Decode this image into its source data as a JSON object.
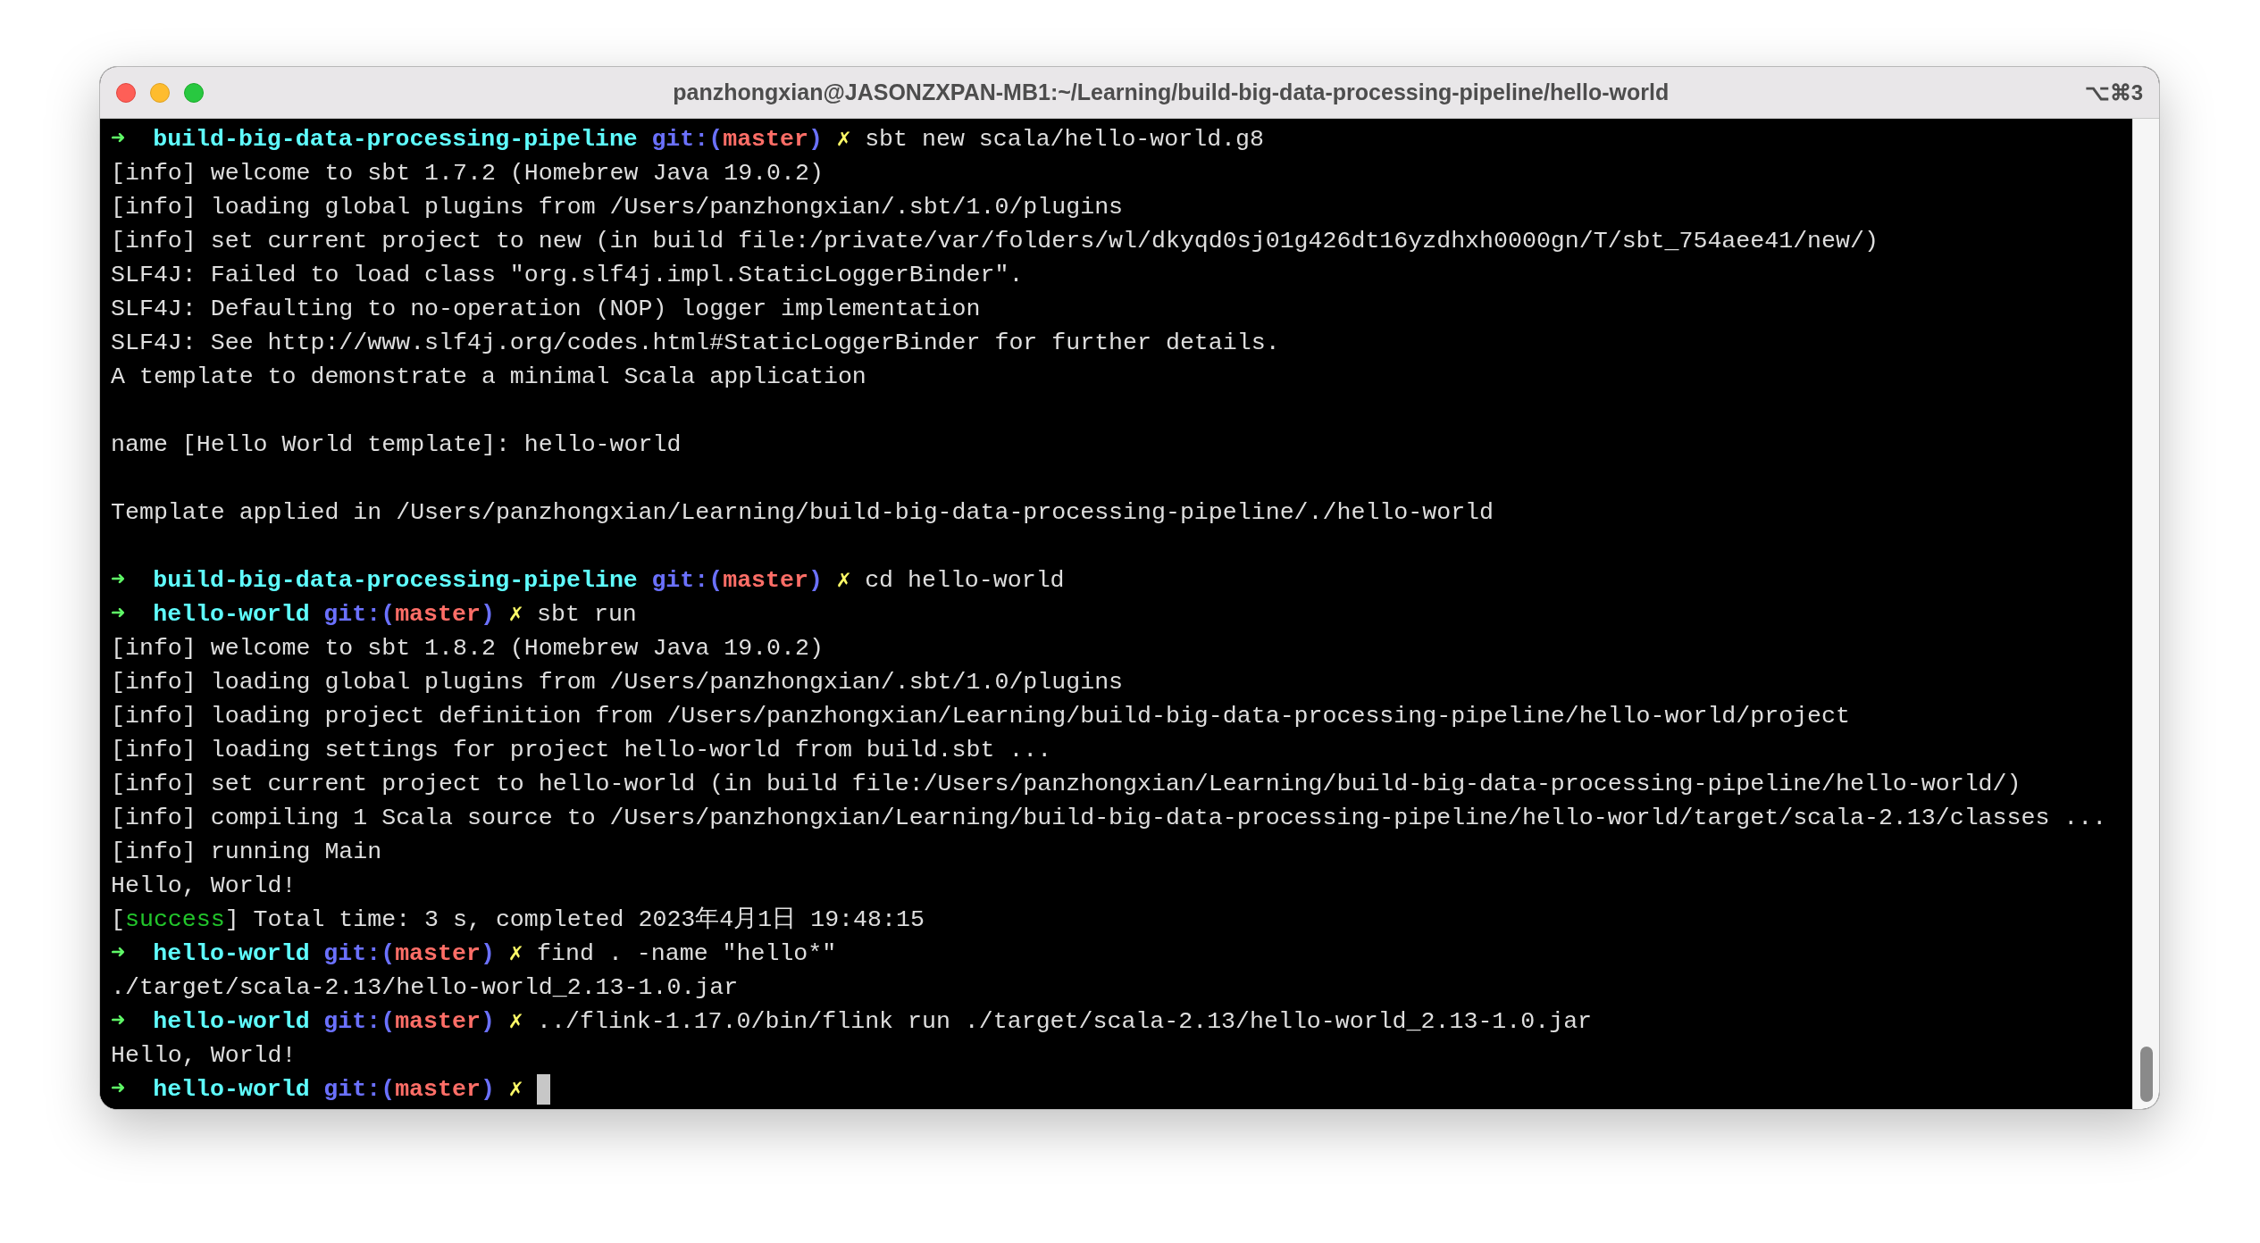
{
  "window": {
    "title": "panzhongxian@JASONZXPAN-MB1:~/Learning/build-big-data-processing-pipeline/hello-world",
    "shortcut": "⌥⌘3"
  },
  "lines": [
    {
      "kind": "prompt",
      "arrow": "➜",
      "dir": "build-big-data-processing-pipeline",
      "git_prefix": "git:(",
      "branch": "master",
      "git_suffix": ")",
      "dirty": "✗",
      "command": "sbt new scala/hello-world.g8",
      "cursor": false
    },
    {
      "kind": "output",
      "text": "[info] welcome to sbt 1.7.2 (Homebrew Java 19.0.2)"
    },
    {
      "kind": "output",
      "text": "[info] loading global plugins from /Users/panzhongxian/.sbt/1.0/plugins"
    },
    {
      "kind": "output",
      "text": "[info] set current project to new (in build file:/private/var/folders/wl/dkyqd0sj01g426dt16yzdhxh0000gn/T/sbt_754aee41/new/)"
    },
    {
      "kind": "output",
      "text": "SLF4J: Failed to load class \"org.slf4j.impl.StaticLoggerBinder\"."
    },
    {
      "kind": "output",
      "text": "SLF4J: Defaulting to no-operation (NOP) logger implementation"
    },
    {
      "kind": "output",
      "text": "SLF4J: See http://www.slf4j.org/codes.html#StaticLoggerBinder for further details."
    },
    {
      "kind": "output",
      "text": "A template to demonstrate a minimal Scala application"
    },
    {
      "kind": "blank"
    },
    {
      "kind": "output",
      "text": "name [Hello World template]: hello-world"
    },
    {
      "kind": "blank"
    },
    {
      "kind": "output",
      "text": "Template applied in /Users/panzhongxian/Learning/build-big-data-processing-pipeline/./hello-world"
    },
    {
      "kind": "blank"
    },
    {
      "kind": "prompt",
      "arrow": "➜",
      "dir": "build-big-data-processing-pipeline",
      "git_prefix": "git:(",
      "branch": "master",
      "git_suffix": ")",
      "dirty": "✗",
      "command": "cd hello-world",
      "cursor": false
    },
    {
      "kind": "prompt",
      "arrow": "➜",
      "dir": "hello-world",
      "git_prefix": "git:(",
      "branch": "master",
      "git_suffix": ")",
      "dirty": "✗",
      "command": "sbt run",
      "cursor": false
    },
    {
      "kind": "output",
      "text": "[info] welcome to sbt 1.8.2 (Homebrew Java 19.0.2)"
    },
    {
      "kind": "output",
      "text": "[info] loading global plugins from /Users/panzhongxian/.sbt/1.0/plugins"
    },
    {
      "kind": "output",
      "text": "[info] loading project definition from /Users/panzhongxian/Learning/build-big-data-processing-pipeline/hello-world/project"
    },
    {
      "kind": "output",
      "text": "[info] loading settings for project hello-world from build.sbt ..."
    },
    {
      "kind": "output",
      "text": "[info] set current project to hello-world (in build file:/Users/panzhongxian/Learning/build-big-data-processing-pipeline/hello-world/)"
    },
    {
      "kind": "output",
      "text": "[info] compiling 1 Scala source to /Users/panzhongxian/Learning/build-big-data-processing-pipeline/hello-world/target/scala-2.13/classes ..."
    },
    {
      "kind": "output",
      "text": "[info] running Main"
    },
    {
      "kind": "output",
      "text": "Hello, World!"
    },
    {
      "kind": "status",
      "prefix": "[",
      "tag": "success",
      "suffix": "] Total time: 3 s, completed 2023年4月1日 19:48:15"
    },
    {
      "kind": "prompt",
      "arrow": "➜",
      "dir": "hello-world",
      "git_prefix": "git:(",
      "branch": "master",
      "git_suffix": ")",
      "dirty": "✗",
      "command": "find . -name \"hello*\"",
      "cursor": false
    },
    {
      "kind": "output",
      "text": "./target/scala-2.13/hello-world_2.13-1.0.jar"
    },
    {
      "kind": "prompt",
      "arrow": "➜",
      "dir": "hello-world",
      "git_prefix": "git:(",
      "branch": "master",
      "git_suffix": ")",
      "dirty": "✗",
      "command": "../flink-1.17.0/bin/flink run ./target/scala-2.13/hello-world_2.13-1.0.jar",
      "cursor": false
    },
    {
      "kind": "output",
      "text": "Hello, World!"
    },
    {
      "kind": "prompt",
      "arrow": "➜",
      "dir": "hello-world",
      "git_prefix": "git:(",
      "branch": "master",
      "git_suffix": ")",
      "dirty": "✗",
      "cursor": true
    }
  ]
}
